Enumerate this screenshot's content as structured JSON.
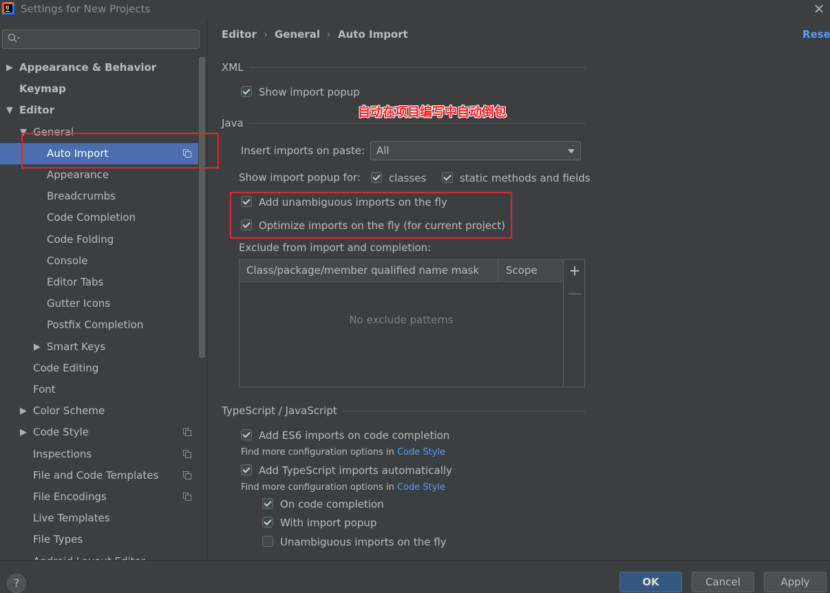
{
  "window": {
    "title": "Settings for New Projects",
    "logo_text": "IJ",
    "close_glyph": "✕"
  },
  "search": {
    "placeholder": "",
    "value": ""
  },
  "sidebar": {
    "items": [
      {
        "label": "Appearance & Behavior",
        "bold": true,
        "arrow": "▶"
      },
      {
        "label": "Keymap",
        "bold": true
      },
      {
        "label": "Editor",
        "bold": true,
        "arrow": "▼"
      },
      {
        "label": "General",
        "arrow": "▼"
      },
      {
        "label": "Auto Import",
        "selected": true,
        "icon": "copy-icon"
      },
      {
        "label": "Appearance"
      },
      {
        "label": "Breadcrumbs"
      },
      {
        "label": "Code Completion"
      },
      {
        "label": "Code Folding"
      },
      {
        "label": "Console"
      },
      {
        "label": "Editor Tabs"
      },
      {
        "label": "Gutter Icons"
      },
      {
        "label": "Postfix Completion"
      },
      {
        "label": "Smart Keys",
        "arrow": "▶"
      },
      {
        "label": "Code Editing"
      },
      {
        "label": "Font"
      },
      {
        "label": "Color Scheme",
        "arrow": "▶"
      },
      {
        "label": "Code Style",
        "arrow": "▶",
        "icon": "copy-icon"
      },
      {
        "label": "Inspections",
        "icon": "copy-icon"
      },
      {
        "label": "File and Code Templates",
        "icon": "copy-icon"
      },
      {
        "label": "File Encodings",
        "icon": "copy-icon"
      },
      {
        "label": "Live Templates"
      },
      {
        "label": "File Types"
      },
      {
        "label": "Android Layout Editor"
      }
    ]
  },
  "breadcrumb": {
    "items": [
      "Editor",
      "General",
      "Auto Import"
    ],
    "separator": "›"
  },
  "reset_label": "Reset",
  "xml": {
    "title": "XML",
    "show_import_popup": {
      "label": "Show import popup",
      "checked": true
    }
  },
  "annotation": {
    "text": "自动在项目编写中自动倒包"
  },
  "java": {
    "title": "Java",
    "insert_imports_label": "Insert imports on paste:",
    "insert_imports_value": "All",
    "show_popup_for_label": "Show import popup for:",
    "classes": {
      "label": "classes",
      "checked": true
    },
    "static_methods": {
      "label": "static methods and fields",
      "checked": true
    },
    "add_unambiguous": {
      "label": "Add unambiguous imports on the fly",
      "checked": true
    },
    "optimize_imports": {
      "label": "Optimize imports on the fly (for current project)",
      "checked": true
    },
    "exclude_label": "Exclude from import and completion:",
    "table": {
      "columns": [
        "Class/package/member qualified name mask",
        "Scope"
      ],
      "empty_text": "No exclude patterns",
      "add_glyph": "+",
      "remove_glyph": "—"
    }
  },
  "typescript": {
    "title": "TypeScript / JavaScript",
    "es6_imports": {
      "label": "Add ES6 imports on code completion",
      "checked": true
    },
    "find_more_1": {
      "prefix": "Find more configuration options in",
      "link": "Code Style"
    },
    "ts_imports": {
      "label": "Add TypeScript imports automatically",
      "checked": true
    },
    "find_more_2": {
      "prefix": "Find more configuration options in",
      "link": "Code Style"
    },
    "on_code_completion": {
      "label": "On code completion",
      "checked": true
    },
    "with_import_popup": {
      "label": "With import popup",
      "checked": true
    },
    "unambiguous_on_fly": {
      "label": "Unambiguous imports on the fly",
      "checked": false
    }
  },
  "footer": {
    "help_label": "?",
    "ok_label": "OK",
    "cancel_label": "Cancel",
    "apply_label": "Apply"
  },
  "colors": {
    "background": "#3c3f41",
    "selection": "#4b6eaf",
    "link": "#589df6",
    "annotation_red": "#e5252a"
  }
}
